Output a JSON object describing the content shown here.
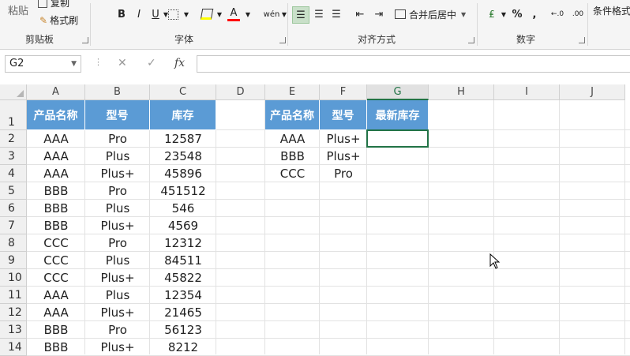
{
  "ribbon": {
    "clipboard": {
      "paste_label": "粘贴",
      "copy_label": "复制",
      "format_painter_label": "格式刷",
      "group_label": "剪贴板"
    },
    "font": {
      "group_label": "字体",
      "bold": "B",
      "italic": "I",
      "underline": "U",
      "font_color": "A",
      "phonetic": "wén"
    },
    "alignment": {
      "group_label": "对齐方式",
      "merge_center_label": "合并后居中"
    },
    "number": {
      "group_label": "数字",
      "percent": "%",
      "comma": ",",
      "inc_decimal": "←.0",
      "dec_decimal": ".00"
    },
    "styles": {
      "conditional_format_label": "条件格式"
    }
  },
  "formula_bar": {
    "name_box": "G2",
    "formula": "",
    "fx": "fx",
    "cancel": "✕",
    "enter": "✓"
  },
  "columns": [
    "A",
    "B",
    "C",
    "D",
    "E",
    "F",
    "G",
    "H",
    "I",
    "J"
  ],
  "rows": [
    "1",
    "2",
    "3",
    "4",
    "5",
    "6",
    "7",
    "8",
    "9",
    "10",
    "11",
    "12",
    "13",
    "14"
  ],
  "table_left": {
    "headers": [
      "产品名称",
      "型号",
      "库存"
    ],
    "rows": [
      [
        "AAA",
        "Pro",
        "12587"
      ],
      [
        "AAA",
        "Plus",
        "23548"
      ],
      [
        "AAA",
        "Plus+",
        "45896"
      ],
      [
        "BBB",
        "Pro",
        "451512"
      ],
      [
        "BBB",
        "Plus",
        "546"
      ],
      [
        "BBB",
        "Plus+",
        "4569"
      ],
      [
        "CCC",
        "Pro",
        "12312"
      ],
      [
        "CCC",
        "Plus",
        "84511"
      ],
      [
        "CCC",
        "Plus+",
        "45822"
      ],
      [
        "AAA",
        "Plus",
        "12354"
      ],
      [
        "AAA",
        "Plus+",
        "21465"
      ],
      [
        "BBB",
        "Pro",
        "56123"
      ],
      [
        "BBB",
        "Plus+",
        "8212"
      ]
    ]
  },
  "table_right": {
    "headers": [
      "产品名称",
      "型号",
      "最新库存"
    ],
    "rows": [
      [
        "AAA",
        "Plus+",
        ""
      ],
      [
        "BBB",
        "Plus+",
        ""
      ],
      [
        "CCC",
        "Pro",
        ""
      ]
    ]
  },
  "colors": {
    "header_fill": "#5b9bd5",
    "selection": "#217346"
  }
}
